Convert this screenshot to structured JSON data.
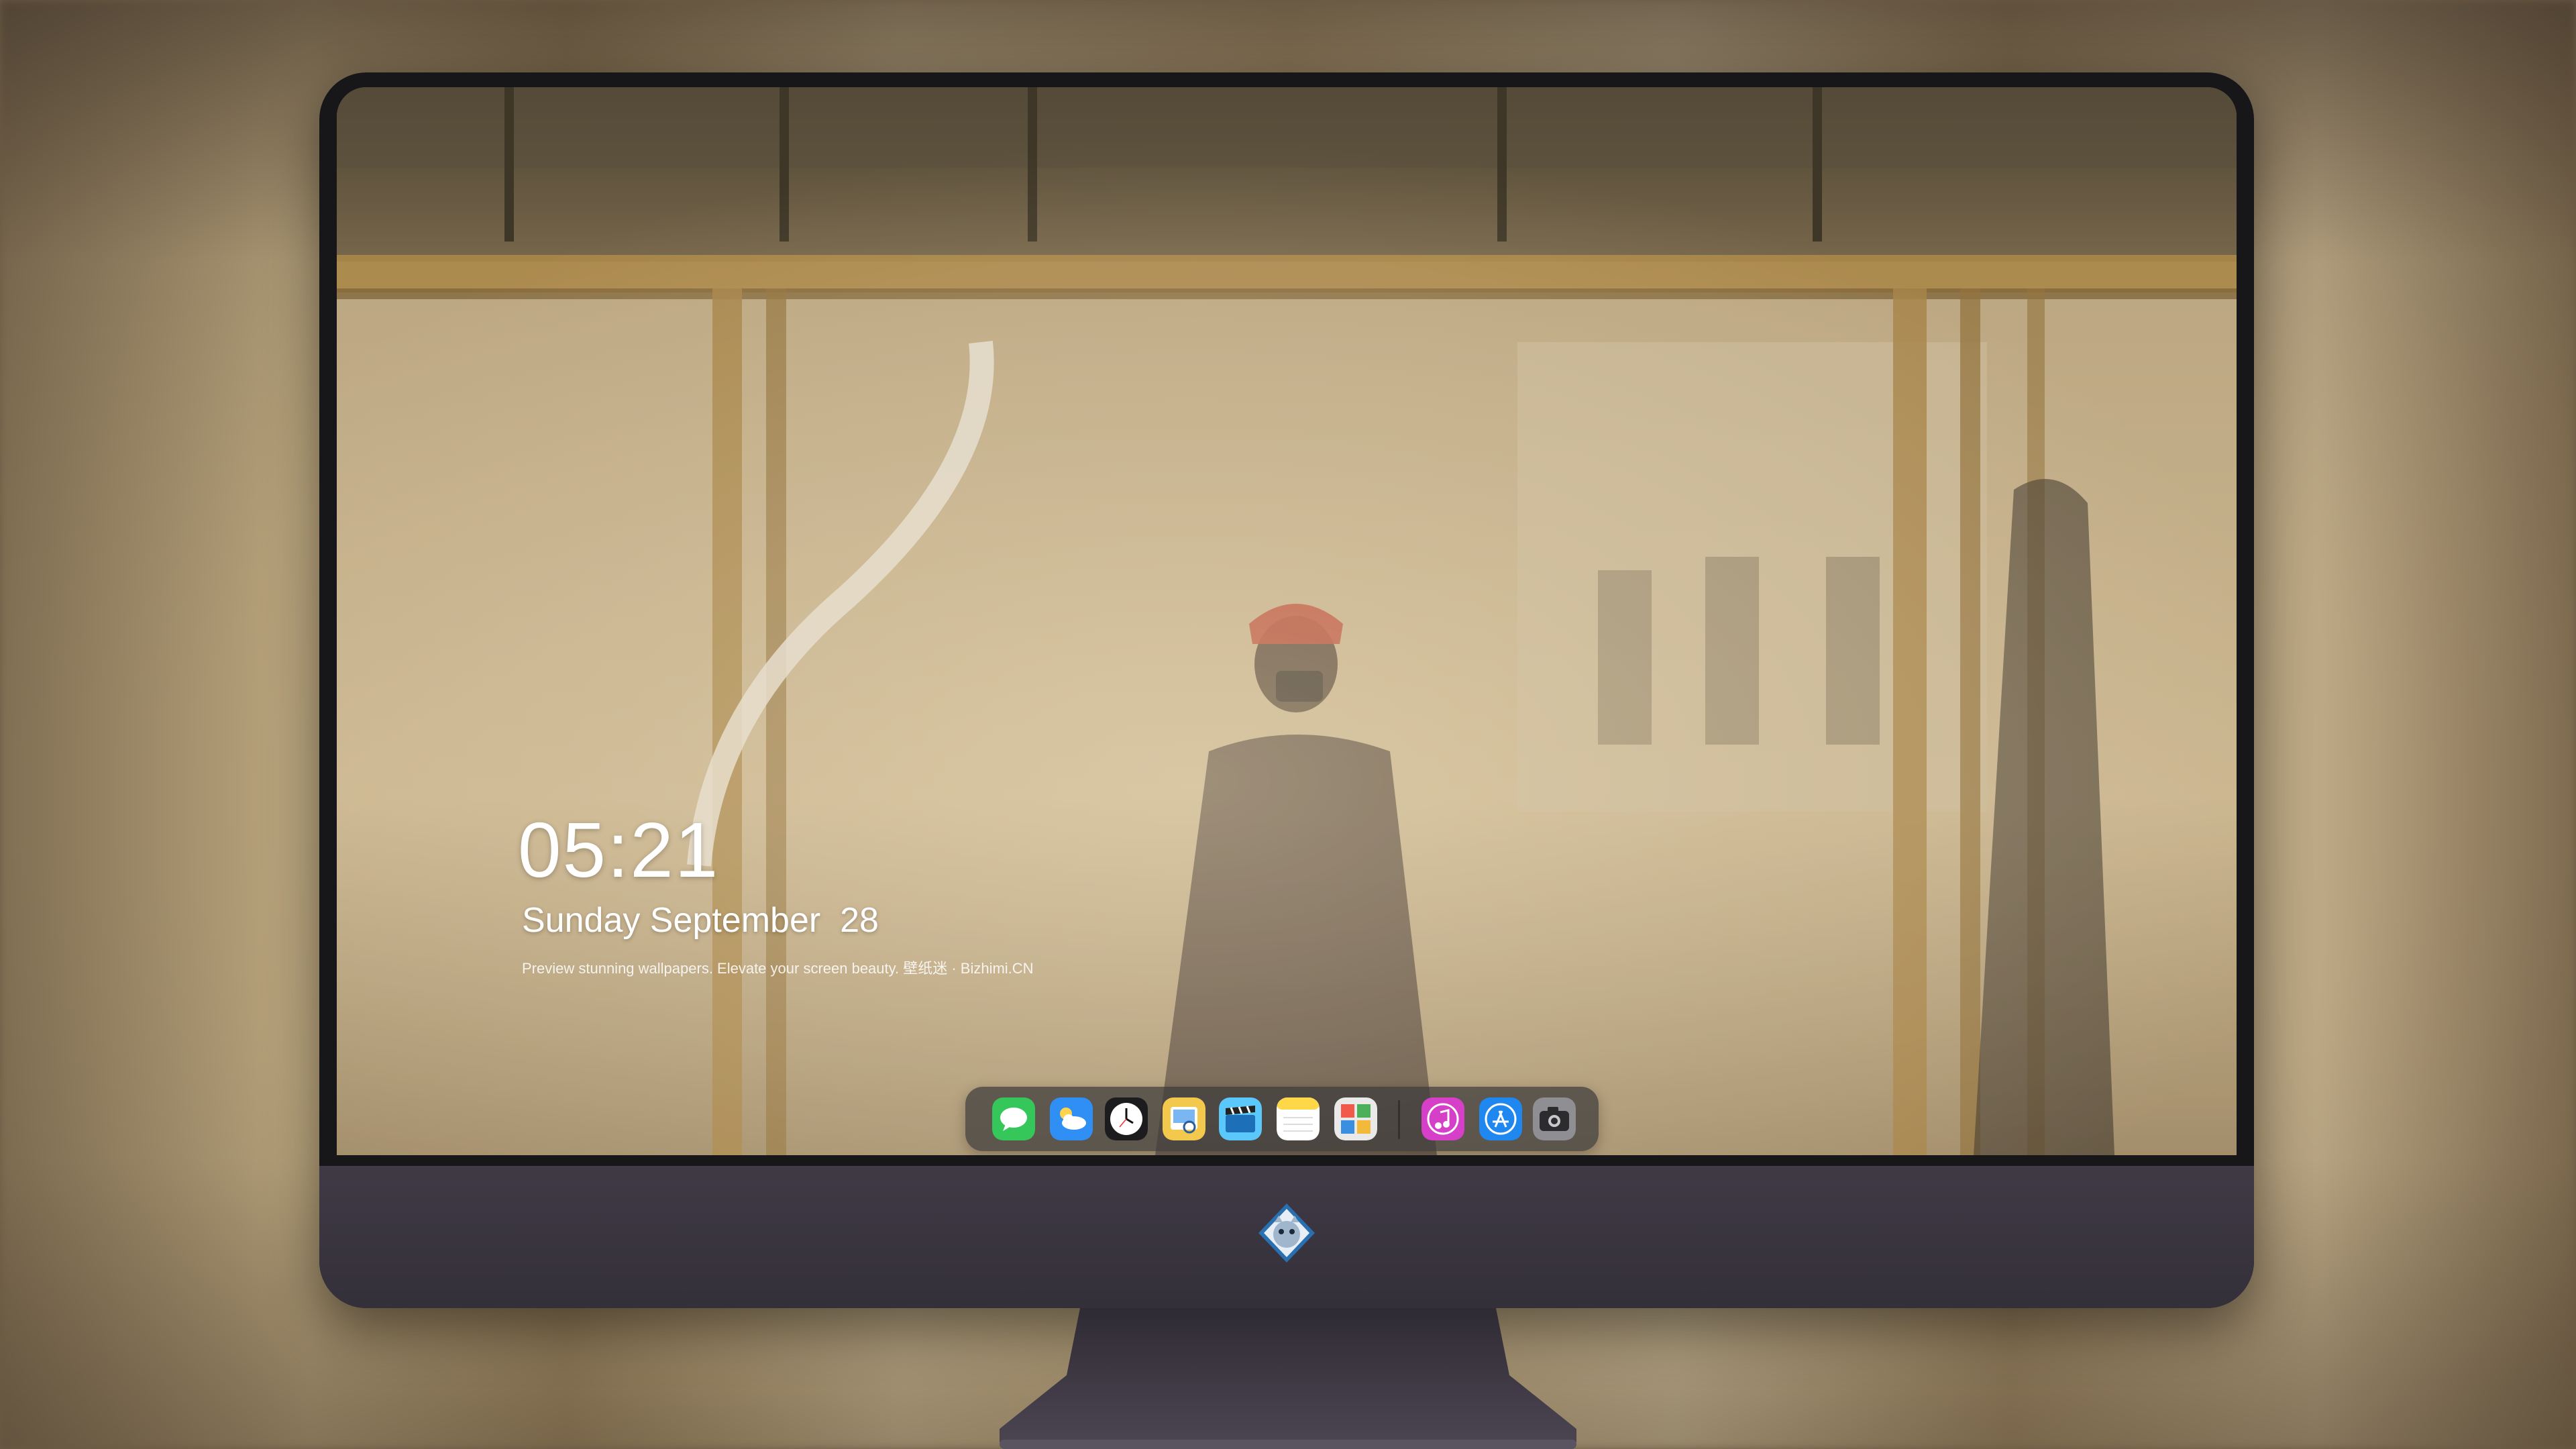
{
  "lockscreen": {
    "time": "05:21",
    "date": "Sunday September  28",
    "tagline": "Preview stunning wallpapers. Elevate your screen beauty. 壁纸迷 · Bizhimi.CN"
  },
  "dock": {
    "items": [
      {
        "name": "messages",
        "icon": "messages-icon",
        "color": "#35c759"
      },
      {
        "name": "weather",
        "icon": "weather-icon",
        "color": "#2f8ff5"
      },
      {
        "name": "clock",
        "icon": "clock-icon",
        "color": "#1c1c1e"
      },
      {
        "name": "preview",
        "icon": "preview-icon",
        "color": "#f2c94c"
      },
      {
        "name": "clips",
        "icon": "clapperboard-icon",
        "color": "#5ac8fa"
      },
      {
        "name": "notes",
        "icon": "notes-icon",
        "color": "#ffd84a"
      },
      {
        "name": "photo-booth",
        "icon": "photo-booth-icon",
        "color": "#f15a4a"
      },
      {
        "name": "music",
        "icon": "music-icon",
        "color": "#d640c8"
      },
      {
        "name": "app-store",
        "icon": "app-store-icon",
        "color": "#1e88f0"
      },
      {
        "name": "camera",
        "icon": "camera-icon",
        "color": "#8e8e93"
      }
    ]
  },
  "colors": {
    "bezel": "#17171a",
    "chin": "#3f3a45",
    "dock_bg": "rgba(60,58,58,0.72)"
  }
}
